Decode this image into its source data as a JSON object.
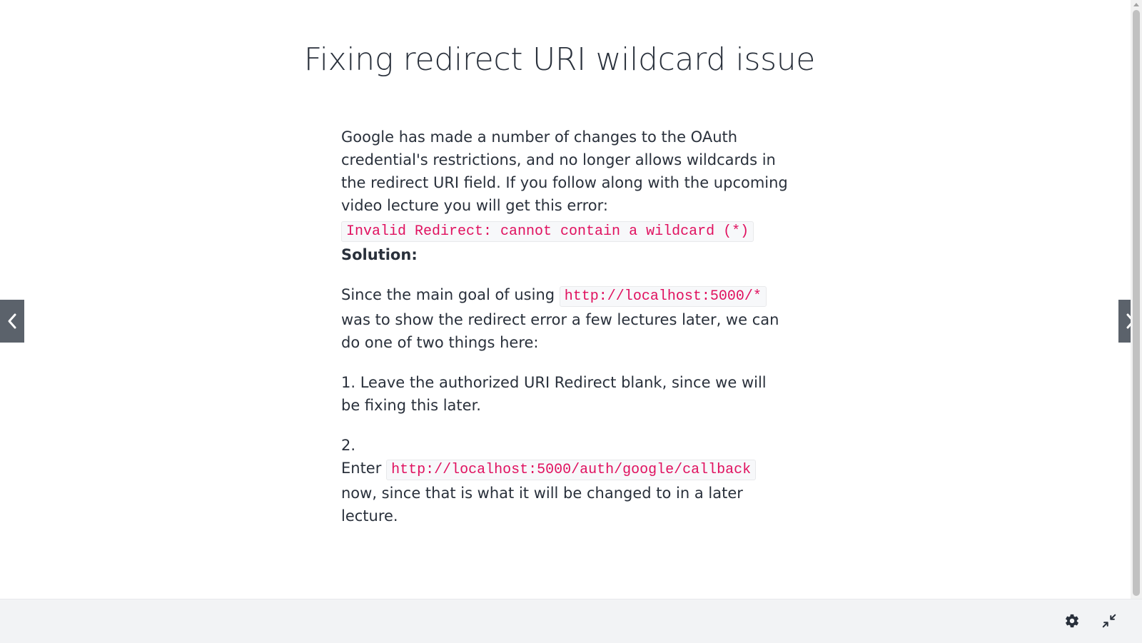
{
  "lecture": {
    "title": "Fixing redirect URI wildcard issue"
  },
  "article": {
    "intro_text": "Google has made a number of changes to the OAuth credential's restrictions, and no longer allows wildcards in the redirect URI field. If you follow along with the upcoming video lecture you will get this error:",
    "error_code": "Invalid Redirect: cannot contain a wildcard (*)",
    "solution_heading": "Solution:",
    "goal_text_before": "Since the main goal of using",
    "goal_code": "http://localhost:5000/*",
    "goal_text_after": "was to show the redirect error a few lectures later,  we can do one of two things here:",
    "option1_text": "1. Leave the authorized URI Redirect blank, since we will be fixing this later.",
    "option2_number": "2.",
    "option2_text_before": "Enter",
    "option2_code": "http://localhost:5000/auth/google/callback",
    "option2_text_after": "now, since that is what it will be changed to in a later lecture."
  },
  "icons": {
    "prev": "chevron-left-icon",
    "next": "chevron-right-icon",
    "settings": "gear-icon",
    "fullscreen": "collapse-icon"
  },
  "colors": {
    "code_text": "#e0115f",
    "nav_arrow_bg": "#5b626b",
    "footer_bg": "#f2f3f5"
  }
}
